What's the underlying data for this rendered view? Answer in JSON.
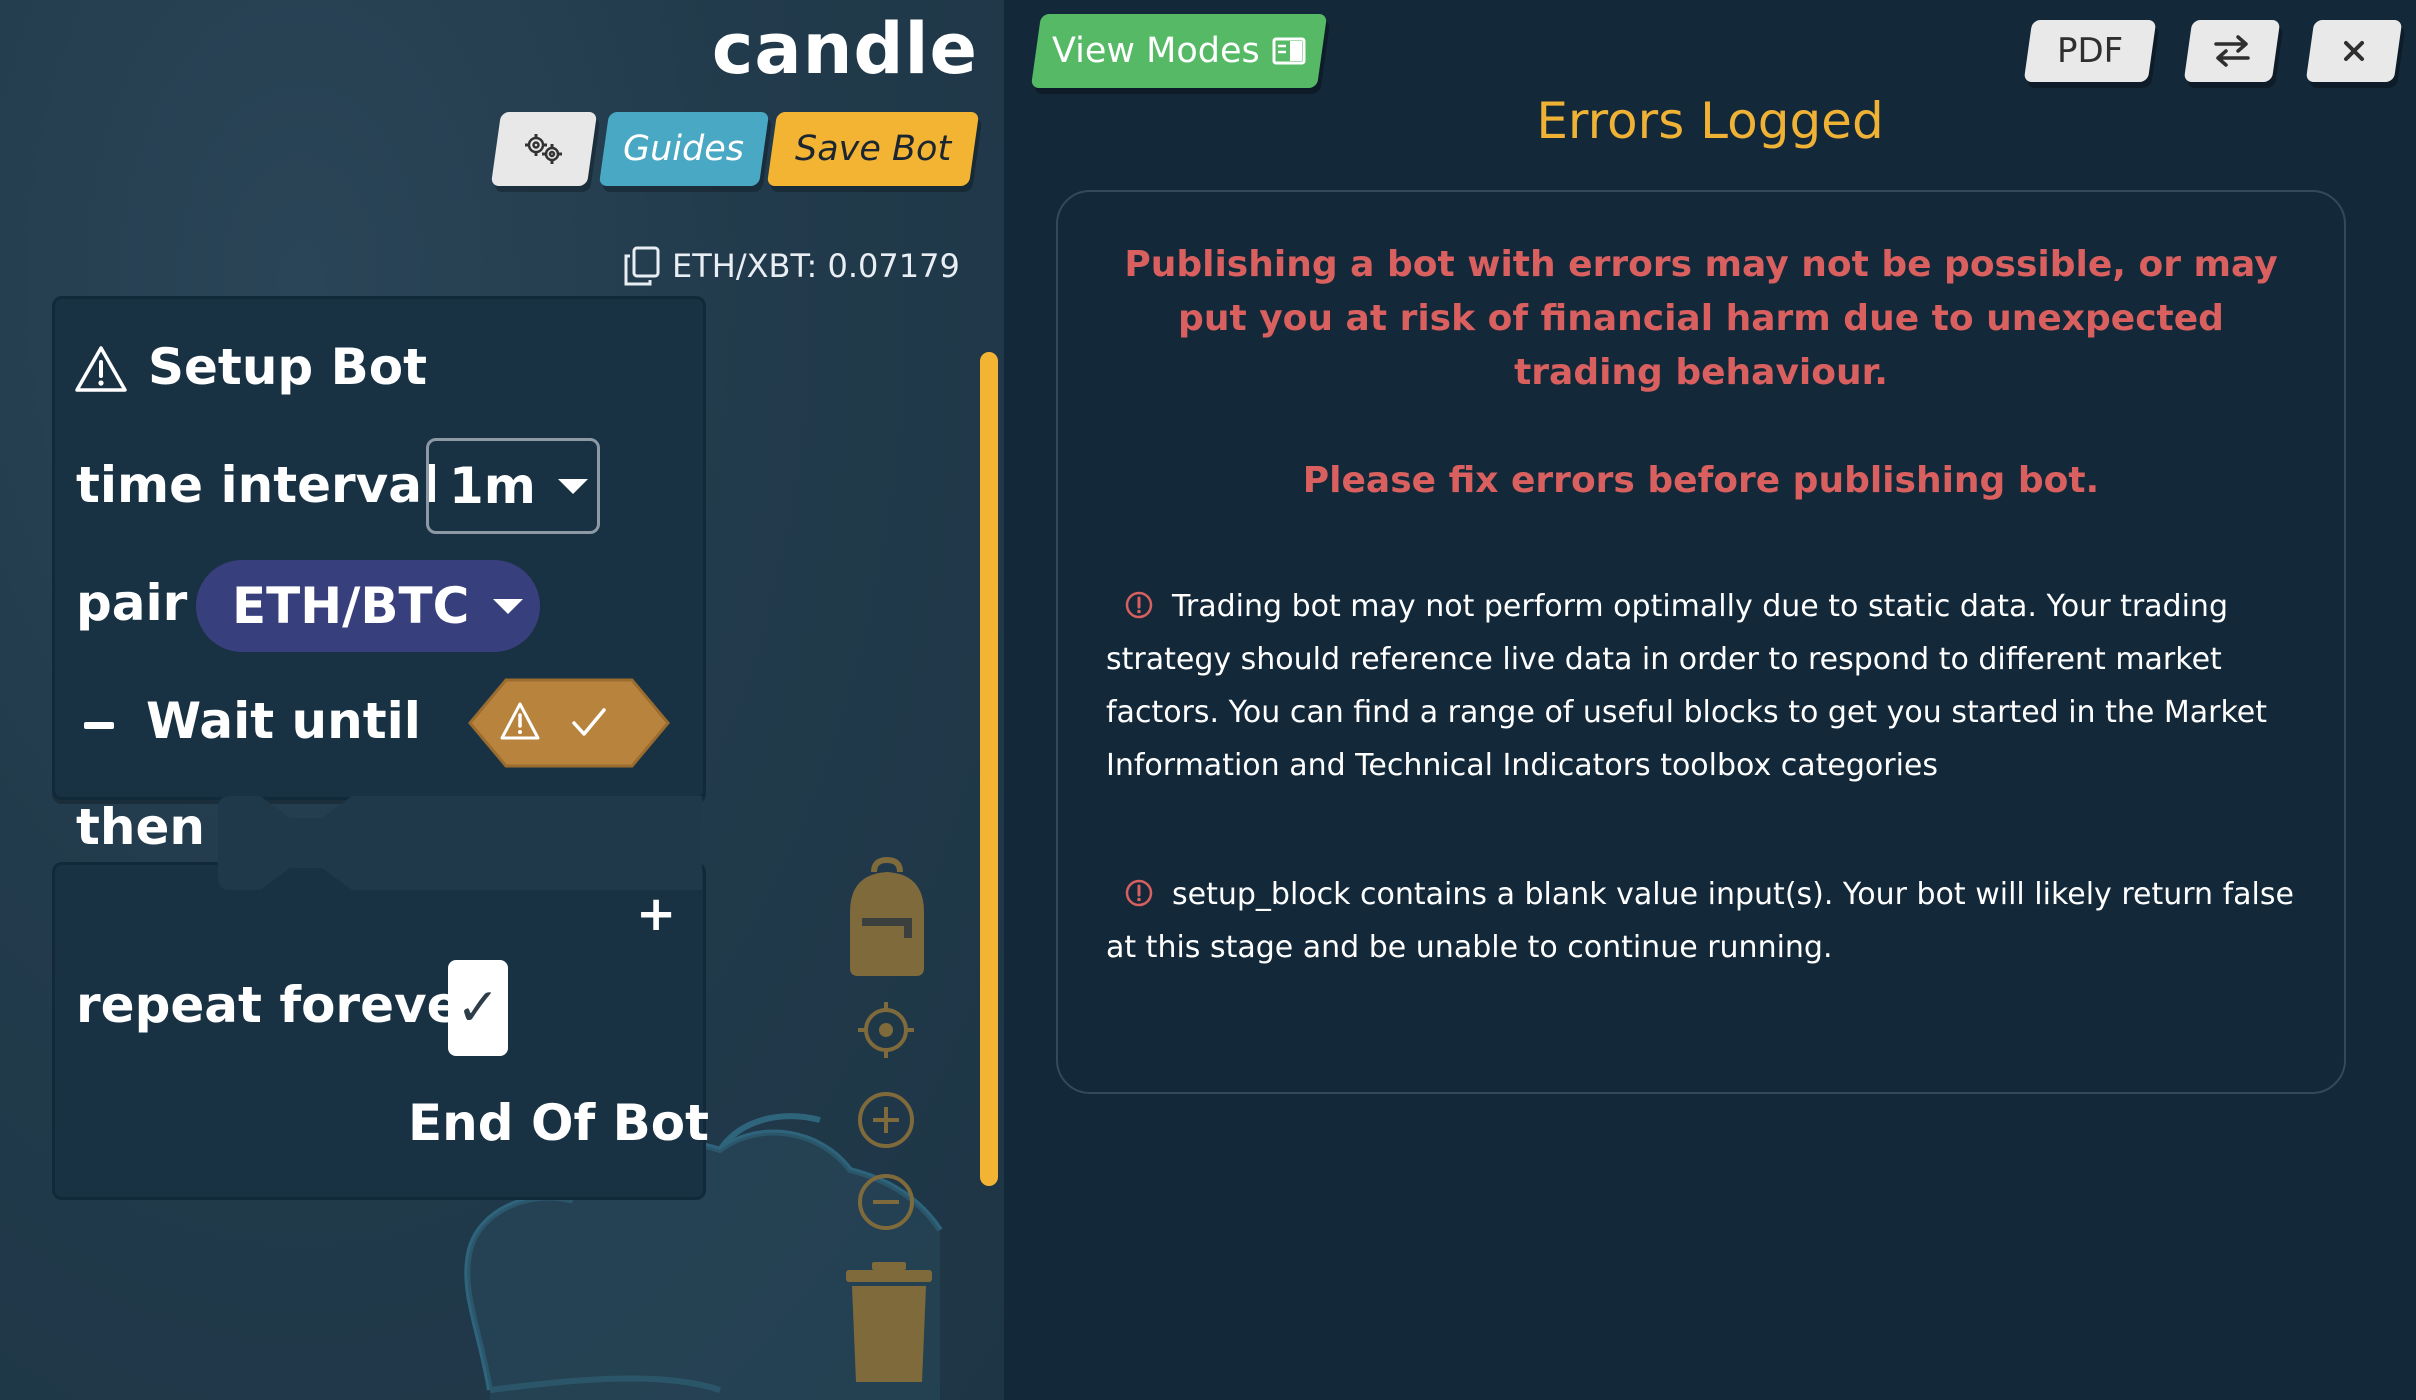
{
  "bot": {
    "name": "candle",
    "price_label": "ETH/XBT: 0.07179"
  },
  "toolbar": {
    "settings_icon": "gears-icon",
    "guides_label": "Guides",
    "save_label": "Save Bot"
  },
  "blocks": {
    "setup_title": "Setup Bot",
    "time_interval_label": "time interval",
    "time_interval_value": "1m",
    "pair_label": "pair",
    "pair_value": "ETH/BTC",
    "wait_label": "Wait until",
    "then_label": "then",
    "repeat_label": "repeat forever",
    "repeat_checked_glyph": "✓",
    "plus_glyph": "+",
    "end_label": "End Of Bot"
  },
  "right_toolbar": {
    "view_modes_label": "View Modes",
    "pdf_label": "PDF"
  },
  "errors": {
    "title": "Errors Logged",
    "warning_main": "Publishing a bot with errors may not be possible, or may put you at risk of financial harm due to unexpected trading behaviour.",
    "warning_fix": "Please fix errors before publishing bot.",
    "items": [
      "Trading bot may not perform optimally due to static data. Your trading strategy should reference live data in order to respond to different market factors. You can find a range of useful blocks to get you started in the Market Information and Technical Indicators toolbox categories",
      "setup_block contains a blank value input(s). Your bot will likely return false at this stage and be unable to continue running."
    ]
  },
  "colors": {
    "accent_yellow": "#f3b433",
    "guides_blue": "#49a8c3",
    "view_modes_green": "#55b966",
    "pair_purple": "#383f7d",
    "error_red": "#d9605e",
    "title_orange": "#f0b235"
  }
}
